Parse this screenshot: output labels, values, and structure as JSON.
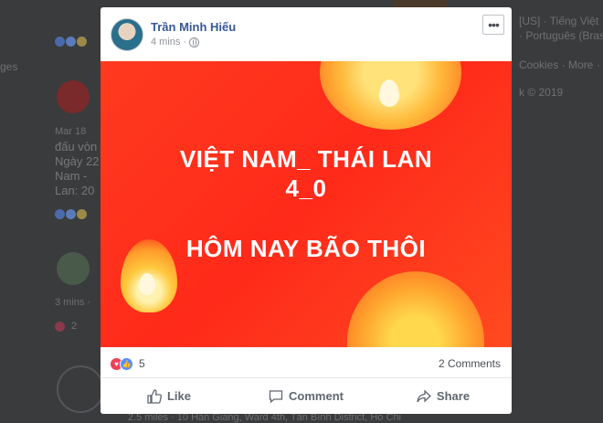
{
  "background": {
    "left_fragments": [
      "ges"
    ],
    "right_lines": [
      "[US] · Tiếng Việt",
      "· Português (Brasi",
      "Cookies · More ·",
      "k © 2019"
    ],
    "feed_post": {
      "date": "Mar 18",
      "lines": [
        "đấu vòn",
        "Ngày 22",
        "Nam - ",
        "Lan: 20"
      ]
    },
    "feed_comment": {
      "time": "3 mins ·",
      "likes": "2"
    },
    "address": "2.5 miles · 10 Hàn Giang, Ward 4th, Tân Bình District, Ho Chi"
  },
  "post": {
    "author": "Trần Minh Hiếu",
    "time": "4 mins",
    "more_label": "•••",
    "banner_lines": [
      "VIỆT NAM_ THÁI LAN",
      "4_0",
      "HÔM NAY BÃO THÔI"
    ],
    "reaction_count": "5",
    "comments_label": "2 Comments",
    "actions": {
      "like": "Like",
      "comment": "Comment",
      "share": "Share"
    }
  },
  "colors": {
    "banner": "#ff3a1f",
    "author_link": "#365899",
    "like_blue": "#5890ff",
    "love_red": "#f33e58"
  },
  "icons": {
    "privacy": "globe-icon",
    "like": "thumbs-up-icon",
    "comment": "speech-bubble-icon",
    "share": "share-arrow-icon"
  }
}
